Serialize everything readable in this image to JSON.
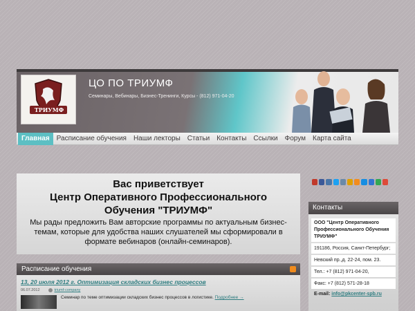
{
  "header": {
    "title": "ЦО ПО ТРИУМФ",
    "slogan": "Семинары, Вебинары, Бизнес-Тренинги, Курсы - (812) 971-04-20",
    "logo_text": "ТРИУМФ"
  },
  "nav": {
    "items": [
      {
        "label": "Главная",
        "active": true
      },
      {
        "label": "Расписание обучения",
        "active": false
      },
      {
        "label": "Наши лекторы",
        "active": false
      },
      {
        "label": "Статьи",
        "active": false
      },
      {
        "label": "Контакты",
        "active": false
      },
      {
        "label": "Ссылки",
        "active": false
      },
      {
        "label": "Форум",
        "active": false
      },
      {
        "label": "Карта сайта",
        "active": false
      }
    ]
  },
  "welcome": {
    "line1": "Вас приветствует",
    "line2": "Центр Оперативного Профессионального",
    "line3": "Обучения \"ТРИУМФ\"",
    "text": "Мы рады предложить Вам авторские программы по актуальным бизнес-темам, которые для удобства наших слушателей мы сформировали в формате вебинаров (онлайн-семинаров)."
  },
  "schedule": {
    "heading": "Расписание обучения",
    "news_title": "13, 20 июля 2012 г. Оптимизация складских бизнес процессов",
    "date": "06.07.2012",
    "author": "triumf-company",
    "text": "Семинар по теме оптимизации складских бизнес процессов в логистике.",
    "more": "Подробнее →"
  },
  "social_icons": [
    "moikrug-icon",
    "facebook-icon",
    "vkontakte-icon",
    "twitter-icon",
    "livejournal-icon",
    "yandex-icon",
    "odnoklassniki-icon",
    "mailru-icon",
    "delicious-icon",
    "google-icon",
    "google-plus-icon"
  ],
  "social_colors": [
    "#c0392b",
    "#3b5998",
    "#4a76a8",
    "#1da1f2",
    "#6b8aa8",
    "#e0a000",
    "#f28c1e",
    "#168de2",
    "#3274d1",
    "#34a853",
    "#dd4b39"
  ],
  "contacts": {
    "heading": "Контакты",
    "org": "ООО \"Центр Оперативного Профессионального Обучения ТРИУМФ\"",
    "address": "191186, Россия, Санкт-Петербург;",
    "street": "Невский пр.,д. 22-24, пом. 23.",
    "phone": "Тел.: +7 (812) 971-04-20,",
    "fax": "Факс: +7 (812) 571-28-18",
    "email_label": "E-mail:",
    "email": "info@pkcenter-spb.ru"
  },
  "colors": {
    "accent": "#5cbfc3",
    "link": "#2e7d80",
    "bar": "#4a4647"
  }
}
